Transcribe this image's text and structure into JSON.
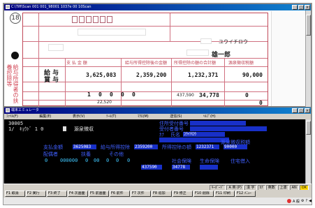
{
  "top_window": {
    "title": "C:\\Tiff\\Scan  001 001_98001  1037e 00 10Scan",
    "buttons": [
      "_",
      "□",
      "×"
    ],
    "form": {
      "circle_number": "18",
      "vertical_label": "給与所得者の扶養控除等",
      "kana_name": "ユウイチロウ",
      "name": "雄一郎",
      "row_payment": "給 与",
      "row_bonus": "賞 与",
      "col_headers": [
        "支 払 金 額",
        "給与所得控除後の金額",
        "所得控除の額の合計額",
        "源泉徴収税額"
      ],
      "amounts": [
        "3,625,083",
        "2,359,200",
        "1,232,371",
        "90,000"
      ],
      "lower_values": [
        "1",
        "0",
        "0",
        "0",
        "0"
      ],
      "lower_amount_1": "22,520",
      "lower_amount_2": "437,590",
      "lower_amount_3": "34,778",
      "lower_amount_4": "0",
      "lower_amount_5": "0"
    }
  },
  "bottom_window": {
    "title": "端末エミュレータ",
    "menu": [
      "ﾌｧｲﾙ(F)",
      "編集(E)",
      "表示(V)",
      "ﾂｰﾙ(T)",
      "ﾏｸﾛ(M)",
      "送信(S)",
      "ﾍﾙﾌﾟ(H)"
    ],
    "lines": {
      "code": "30005",
      "header_left": "1/",
      "header_mid": "ｷｮｳﾄﾞ 1 0",
      "header_right": "源泉徴収",
      "lbl_addr": "住所受付番号",
      "lbl_recv": "受付者番号",
      "lbl_kana": "ｶﾅ",
      "lbl_name": "氏名",
      "kana_value": "ﾕｳｲﾁﾛｳ",
      "lbl_pay": "支払金額",
      "lbl_deduct": "給与所得控除",
      "lbl_total": "所得控除の額",
      "lbl_tax": "源泉徴収税額",
      "pay_value": "3625083",
      "deduct_value": "2359200",
      "total_value": "1232371",
      "tax_value": "90000",
      "lbl_spouse": "配偶者",
      "lbl_dep": "扶養",
      "lbl_other": "その他",
      "row_vals": [
        "0",
        "000000",
        "0",
        "00",
        "0",
        "0",
        "0"
      ],
      "lbl_social": "社会保険",
      "lbl_life": "生命保険",
      "lbl_house": "住宅借入",
      "social_value": "437590",
      "life_value": "34778"
    }
  },
  "status_cells": [
    "ｷｰﾎﾞｰﾄﾞ",
    "A 英 (P)",
    "漢 字",
    "ｶﾅ",
    "英数",
    "上書",
    "AN",
    "OK"
  ],
  "fkeys": [
    "F1 取消",
    "F2 実行",
    "F3 終了",
    "F4 次画面",
    "F5 前画面",
    "F6 前件",
    "F7 次件",
    "F8 追加",
    "F9 修正",
    "F10 削除",
    "F11 印刷",
    "F12 ﾒﾆｭｰ"
  ],
  "tray": [
    "A 般",
    "⚙",
    "?",
    "◀"
  ]
}
